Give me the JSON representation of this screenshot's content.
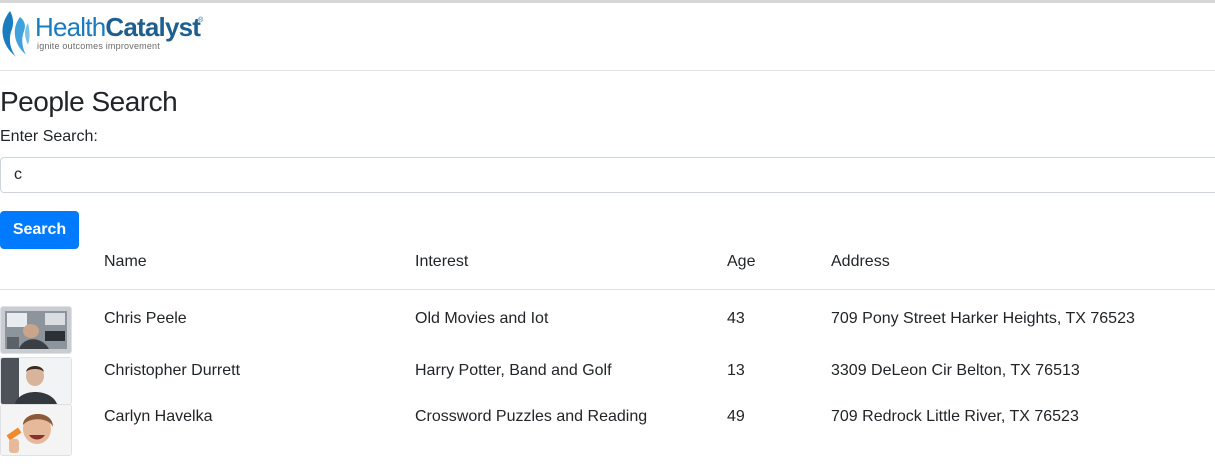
{
  "brand": {
    "name_part1": "Health",
    "name_part2": "Catalyst",
    "tagline": "ignite outcomes improvement",
    "trademark": "®",
    "colors": {
      "primary": "#1a7bbf",
      "dark": "#1f5f8f"
    }
  },
  "page": {
    "title": "People Search",
    "search_label": "Enter Search:",
    "search_value": "c",
    "search_button": "Search",
    "accent_color": "#007bff"
  },
  "table": {
    "columns": [
      "Name",
      "Interest",
      "Age",
      "Address"
    ],
    "rows": [
      {
        "name": "Chris Peele",
        "interest": "Old Movies and Iot",
        "age": "43",
        "address": "709 Pony Street Harker Heights, TX 76523",
        "avatar": "office-photo"
      },
      {
        "name": "Christopher Durrett",
        "interest": "Harry Potter, Band and Golf",
        "age": "13",
        "address": "3309 DeLeon Cir Belton, TX 76513",
        "avatar": "portrait-photo"
      },
      {
        "name": "Carlyn Havelka",
        "interest": "Crossword Puzzles and Reading",
        "age": "49",
        "address": "709 Redrock Little River, TX 76523",
        "avatar": "laughing-photo"
      }
    ]
  }
}
